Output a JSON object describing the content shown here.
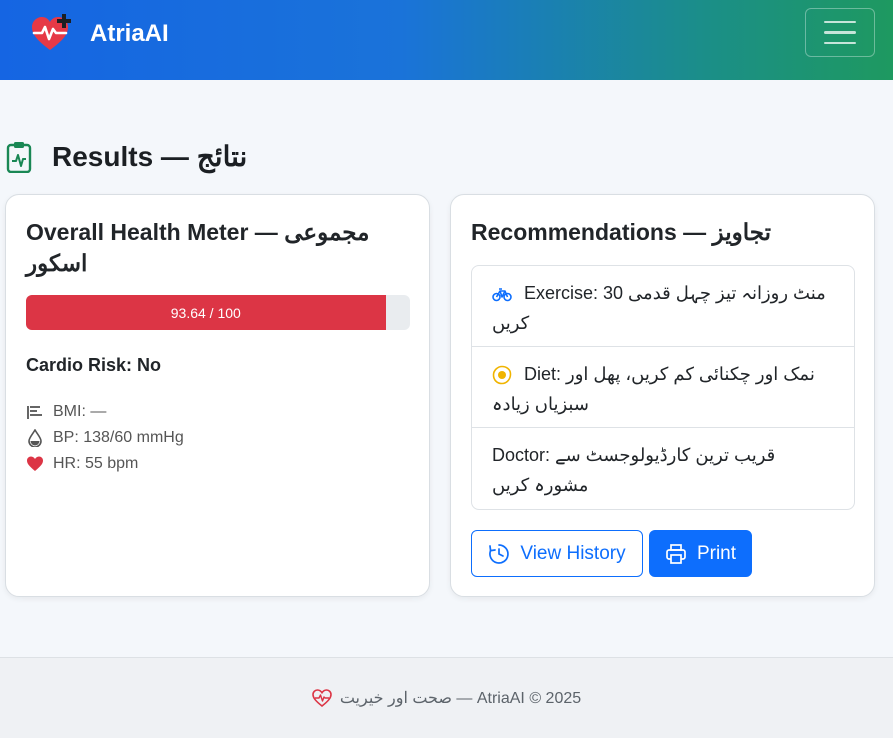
{
  "navbar": {
    "brand": "AtriaAI",
    "logo_icon": "heart-pulse-plus-icon",
    "toggler_icon": "hamburger-menu-icon"
  },
  "page": {
    "heading": "Results — نتائج",
    "heading_icon": "clipboard-pulse-icon"
  },
  "health_card": {
    "title": "Overall Health Meter — مجموعی اسکور",
    "meter_label": "93.64 / 100",
    "meter_value": 93.64,
    "meter_max": 100,
    "meter_color": "#dc3545",
    "cardio_label": "Cardio Risk:",
    "cardio_value": "No",
    "stats": {
      "bmi": "BMI: —",
      "bp": "BP: 138/60 mmHg",
      "hr": "HR: 55 bpm"
    }
  },
  "recommendations_card": {
    "title": "Recommendations — تجاویز",
    "items": [
      {
        "icon": "bicycle-icon",
        "text": "Exercise: 30 منٹ روزانہ تیز چہل قدمی کریں"
      },
      {
        "icon": "egg-fried-icon",
        "text": "Diet: نمک اور چکنائی کم کریں، پھل اور سبزیاں زیادہ"
      },
      {
        "icon": "",
        "text": "Doctor: قریب ترین کارڈیولوجسٹ سے مشورہ کریں"
      }
    ],
    "buttons": {
      "history": "View History",
      "print": "Print"
    }
  },
  "footer": {
    "text": "صحت اور خیریت — AtriaAI © 2025"
  },
  "colors": {
    "primary": "#0d6efd",
    "danger": "#dc3545",
    "nav_gradient_start": "#1565e3",
    "nav_gradient_end": "#1e9960"
  }
}
